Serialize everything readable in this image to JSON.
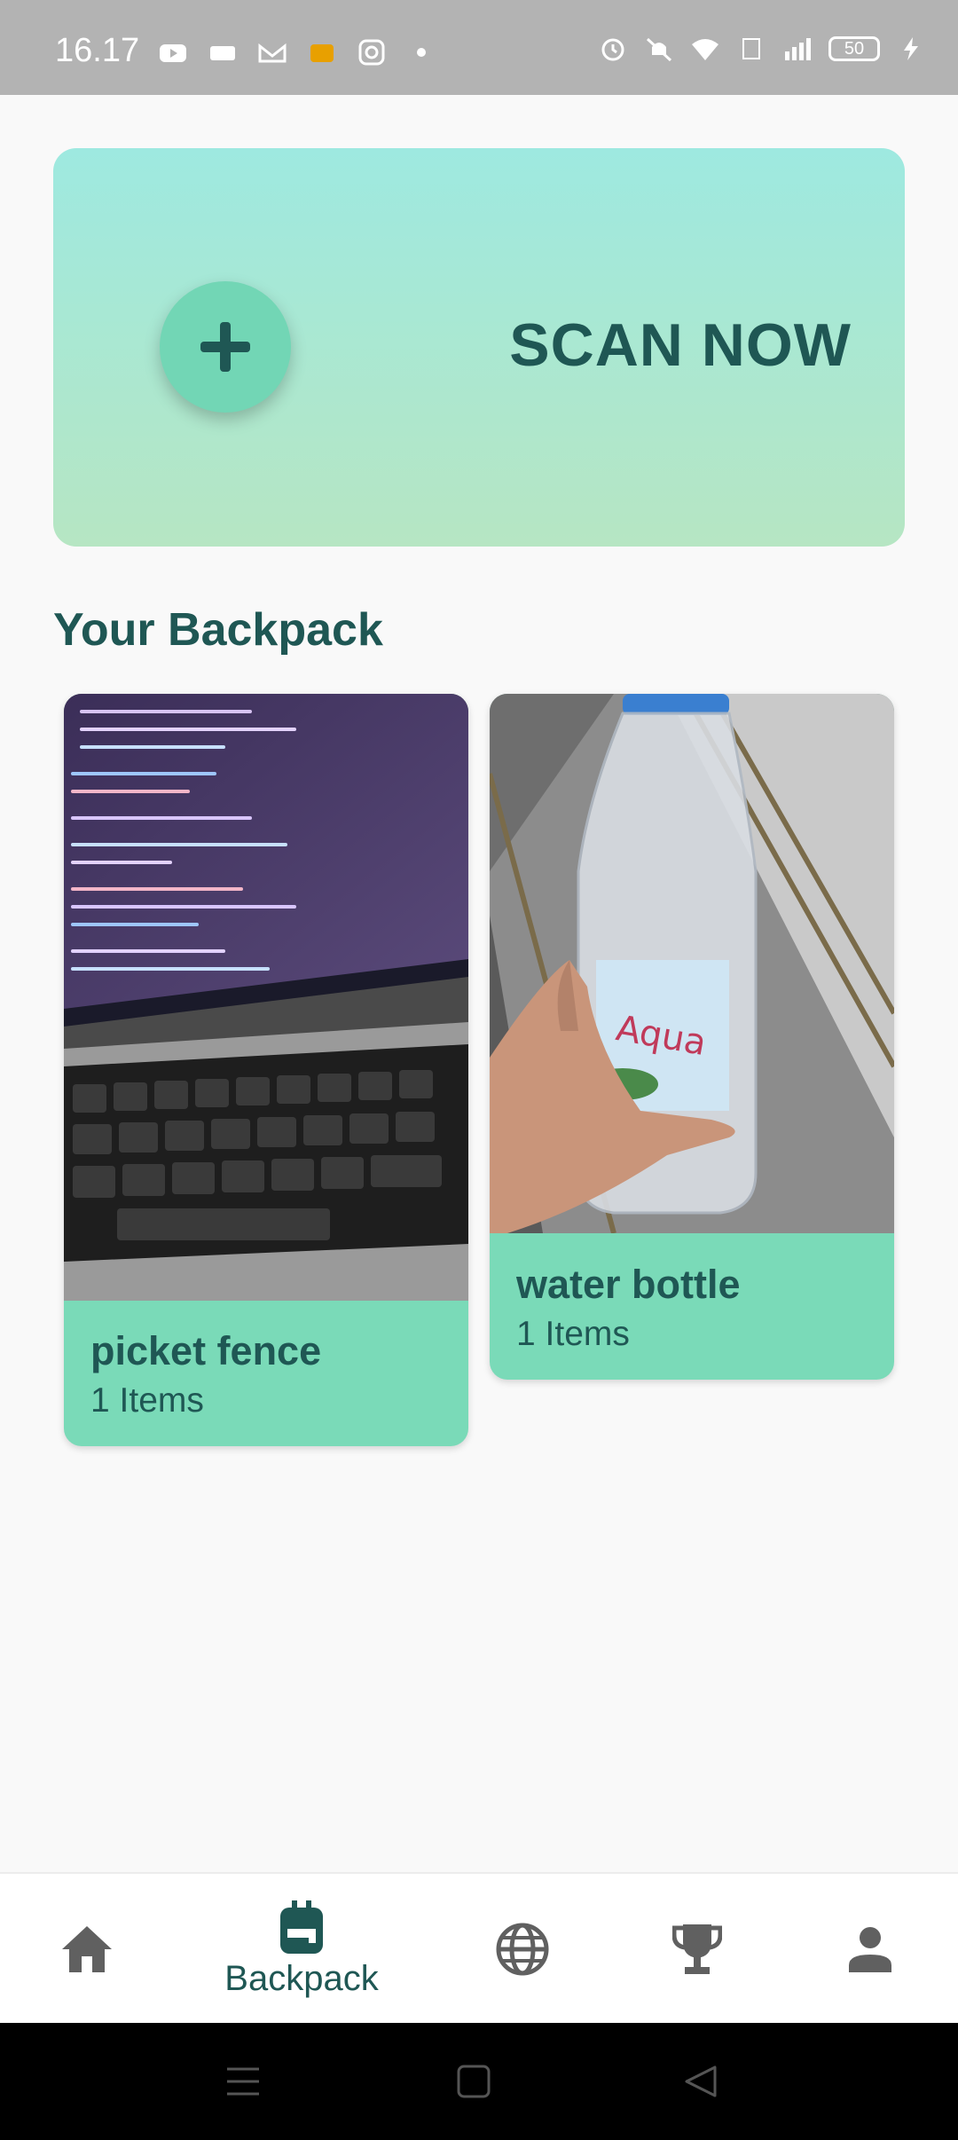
{
  "status_bar": {
    "time": "16.17",
    "battery_level": "50",
    "left_icons": [
      "youtube-icon",
      "message-icon",
      "gmail-icon",
      "app-icon",
      "instagram-icon",
      "dot-icon"
    ],
    "right_icons": [
      "alarm-icon",
      "mute-icon",
      "wifi-icon",
      "volte-icon",
      "signal-icon",
      "battery-icon",
      "charging-icon"
    ]
  },
  "scan": {
    "label": "SCAN NOW"
  },
  "backpack": {
    "title": "Your Backpack",
    "items": [
      {
        "name": "picket fence",
        "count": "1 Items"
      },
      {
        "name": "water bottle",
        "count": "1 Items"
      }
    ]
  },
  "bottom_nav": {
    "active_label": "Backpack",
    "items": [
      "home-icon",
      "backpack-icon",
      "globe-icon",
      "trophy-icon",
      "person-icon"
    ]
  },
  "colors": {
    "accent": "#1f5754",
    "card": "#7adab8",
    "scan_top": "#9ee9e0",
    "scan_bottom": "#b6e6c3"
  }
}
